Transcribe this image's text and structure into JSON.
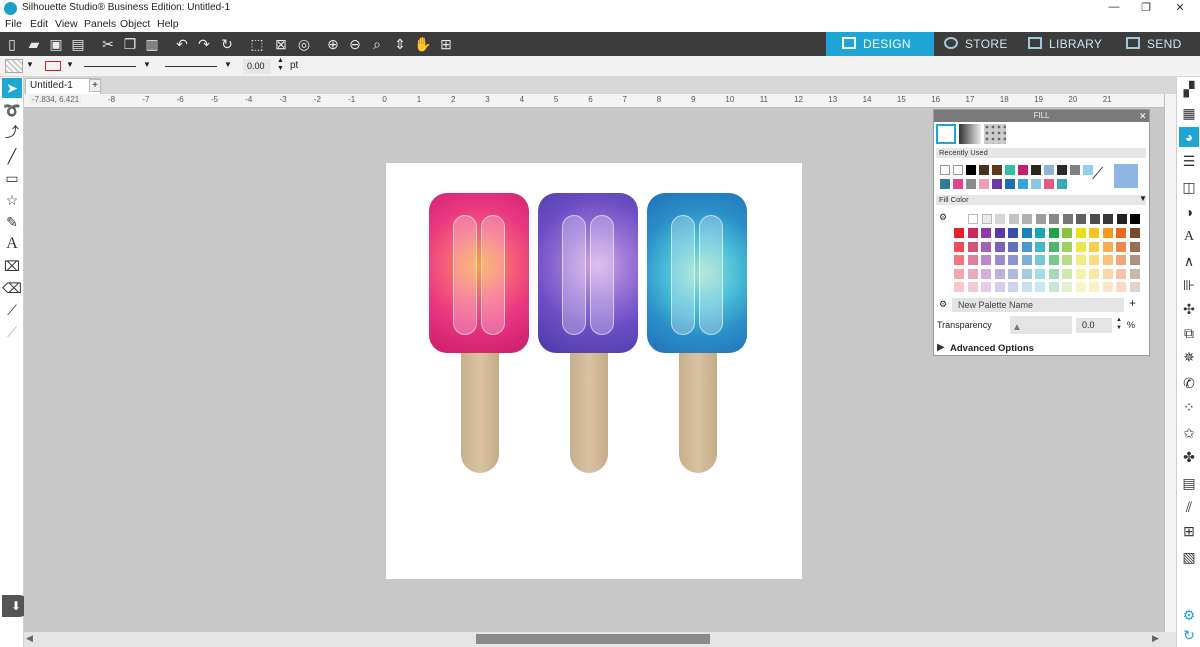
{
  "window": {
    "title": "Silhouette Studio® Business Edition: Untitled-1",
    "minimize": "—",
    "maximize": "❐",
    "close": "✕"
  },
  "menu": [
    "File",
    "Edit",
    "View",
    "Panels",
    "Object",
    "Help"
  ],
  "nav_tabs": {
    "design": "DESIGN",
    "store": "STORE",
    "library": "LIBRARY",
    "send": "SEND"
  },
  "props": {
    "line_width_value": "0.00",
    "unit": "pt"
  },
  "doc_tab": {
    "label": "Untitled-1",
    "add": "+",
    "coordinates": "-7.834, 6.421"
  },
  "ruler": {
    "labels": [
      "-8",
      "-7",
      "-6",
      "-5",
      "-4",
      "-3",
      "-2",
      "-1",
      "0",
      "1",
      "2",
      "3",
      "4",
      "5",
      "6",
      "7",
      "8",
      "9",
      "10",
      "11",
      "12",
      "13",
      "14",
      "15",
      "16",
      "17",
      "18",
      "19",
      "20",
      "21"
    ]
  },
  "fill_panel": {
    "title": "FILL",
    "recently_used": "Recently Used",
    "fill_color": "Fill Color",
    "palette_name_placeholder": "New Palette Name",
    "add": "+",
    "transparency_label": "Transparency",
    "transparency_value": "0.0",
    "percent": "%",
    "advanced": "Advanced Options",
    "recent_row1": [
      "#ffffff",
      "#ffffff",
      "#000000",
      "#4a2e1e",
      "#5c3a1c",
      "#2fc1a4",
      "#c41e6a",
      "#2b2418",
      "#8db3d8",
      "#2b2b2b",
      "#808080",
      "#8fd1e8"
    ],
    "recent_row2": [
      "#2e7e9a",
      "#e2458b",
      "#8c8c8c",
      "#ee9eb6",
      "#6a3aa4",
      "#1f6fb0",
      "#3aa3d6",
      "#8ac6e8",
      "#e85b80",
      "#3aaab8"
    ],
    "grays": [
      "#ffffff",
      "#e9e9e9",
      "#d6d6d6",
      "#c4c4c4",
      "#b0b0b0",
      "#9c9c9c",
      "#888888",
      "#747474",
      "#606060",
      "#4c4c4c",
      "#383838",
      "#222222",
      "#000000"
    ],
    "hues": [
      "#e8202a",
      "#c82a5a",
      "#8c3aa4",
      "#5a3aa4",
      "#3a4ea8",
      "#1f7ec0",
      "#17a7b8",
      "#1fa34a",
      "#8bc23a",
      "#e8e01f",
      "#f8c21f",
      "#f89a1f",
      "#e86a1f",
      "#7a4a2a"
    ]
  }
}
